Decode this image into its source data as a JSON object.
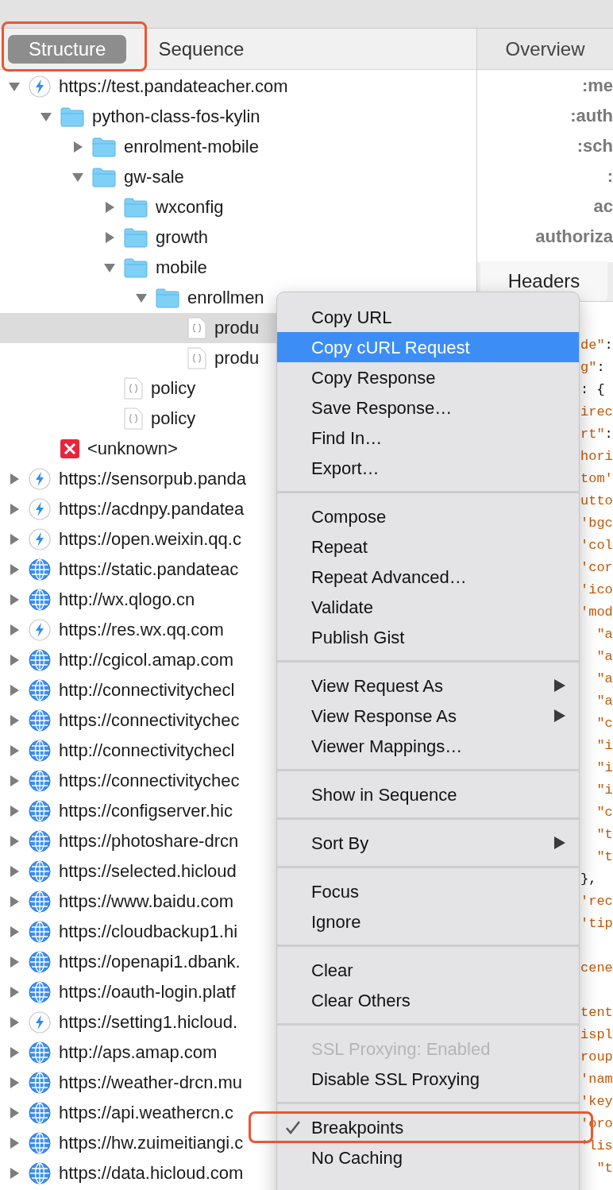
{
  "tabs": [
    {
      "label": "Structure",
      "selected": true,
      "annotated": true
    },
    {
      "label": "Sequence",
      "selected": false,
      "annotated": false
    }
  ],
  "tree": [
    {
      "label": "https://test.pandateacher.com",
      "kind": "lightning",
      "expanded": true,
      "selected": false,
      "children": [
        {
          "label": "python-class-fos-kylin",
          "kind": "folder",
          "expanded": true,
          "selected": false,
          "children": [
            {
              "label": "enrolment-mobile",
              "kind": "folder",
              "expanded": false,
              "selected": false
            },
            {
              "label": "gw-sale",
              "kind": "folder",
              "expanded": true,
              "selected": false,
              "children": [
                {
                  "label": "wxconfig",
                  "kind": "folder",
                  "expanded": false,
                  "selected": false
                },
                {
                  "label": "growth",
                  "kind": "folder",
                  "expanded": false,
                  "selected": false
                },
                {
                  "label": "mobile",
                  "kind": "folder",
                  "expanded": true,
                  "selected": false,
                  "children": [
                    {
                      "label": "enrollmen",
                      "kind": "folder",
                      "expanded": true,
                      "selected": false,
                      "children": [
                        {
                          "label": "produ",
                          "kind": "json",
                          "selected": true
                        },
                        {
                          "label": "produ",
                          "kind": "json",
                          "selected": false
                        }
                      ]
                    }
                  ]
                },
                {
                  "label": "policy",
                  "kind": "json",
                  "selected": false
                },
                {
                  "label": "policy",
                  "kind": "json",
                  "selected": false
                }
              ]
            }
          ]
        },
        {
          "label": "<unknown>",
          "kind": "error",
          "selected": false
        }
      ]
    },
    {
      "label": "https://sensorpub.panda",
      "kind": "lightning",
      "expanded": false,
      "selected": false
    },
    {
      "label": "https://acdnpy.pandatea",
      "kind": "lightning",
      "expanded": false,
      "selected": false
    },
    {
      "label": "https://open.weixin.qq.c",
      "kind": "lightning",
      "expanded": false,
      "selected": false
    },
    {
      "label": "https://static.pandateac",
      "kind": "globe",
      "expanded": false,
      "selected": false
    },
    {
      "label": "http://wx.qlogo.cn",
      "kind": "globe",
      "expanded": false,
      "selected": false
    },
    {
      "label": "https://res.wx.qq.com",
      "kind": "lightning",
      "expanded": false,
      "selected": false
    },
    {
      "label": "http://cgicol.amap.com",
      "kind": "globe",
      "expanded": false,
      "selected": false
    },
    {
      "label": "http://connectivitychecl",
      "kind": "globe",
      "expanded": false,
      "selected": false
    },
    {
      "label": "https://connectivitychec",
      "kind": "globe",
      "expanded": false,
      "selected": false
    },
    {
      "label": "http://connectivitychecl",
      "kind": "globe",
      "expanded": false,
      "selected": false
    },
    {
      "label": "https://connectivitychec",
      "kind": "globe",
      "expanded": false,
      "selected": false
    },
    {
      "label": "https://configserver.hic",
      "kind": "globe",
      "expanded": false,
      "selected": false
    },
    {
      "label": "https://photoshare-drcn",
      "kind": "globe",
      "expanded": false,
      "selected": false
    },
    {
      "label": "https://selected.hicloud",
      "kind": "globe",
      "expanded": false,
      "selected": false
    },
    {
      "label": "https://www.baidu.com",
      "kind": "globe",
      "expanded": false,
      "selected": false
    },
    {
      "label": "https://cloudbackup1.hi",
      "kind": "globe",
      "expanded": false,
      "selected": false
    },
    {
      "label": "https://openapi1.dbank.",
      "kind": "globe",
      "expanded": false,
      "selected": false
    },
    {
      "label": "https://oauth-login.platf",
      "kind": "globe",
      "expanded": false,
      "selected": false
    },
    {
      "label": "https://setting1.hicloud.",
      "kind": "lightning",
      "expanded": false,
      "selected": false
    },
    {
      "label": "http://aps.amap.com",
      "kind": "globe",
      "expanded": false,
      "selected": false
    },
    {
      "label": "https://weather-drcn.mu",
      "kind": "globe",
      "expanded": false,
      "selected": false
    },
    {
      "label": "https://api.weathercn.c",
      "kind": "globe",
      "expanded": false,
      "selected": false
    },
    {
      "label": "https://hw.zuimeitiangi.c",
      "kind": "globe",
      "expanded": false,
      "selected": false
    },
    {
      "label": "https://data.hicloud.com",
      "kind": "globe",
      "expanded": false,
      "selected": false
    }
  ],
  "overview": {
    "title": "Overview",
    "labels": [
      ":me",
      ":auth",
      ":sch",
      ":",
      "ac",
      "authoriza"
    ],
    "tab": "Headers"
  },
  "code_lines": [
    {
      "kind": "code",
      "text": "de\"",
      "punct": ":"
    },
    {
      "kind": "code",
      "text": "g\"",
      "punct": ":"
    },
    {
      "kind": "code",
      "punct": ": {"
    },
    {
      "kind": "code",
      "text": "irec"
    },
    {
      "kind": "code",
      "text": "rt\"",
      "punct": ":"
    },
    {
      "kind": "code",
      "text": "hori"
    },
    {
      "kind": "code",
      "text": "tom'"
    },
    {
      "kind": "code",
      "text": "utto"
    },
    {
      "kind": "code",
      "text": "'bgc"
    },
    {
      "kind": "code",
      "text": "'col"
    },
    {
      "kind": "code",
      "text": "'cor"
    },
    {
      "kind": "code",
      "text": "'ico"
    },
    {
      "kind": "code",
      "text": "'mod"
    },
    {
      "kind": "code",
      "text": "  \"a"
    },
    {
      "kind": "code",
      "text": "  \"a"
    },
    {
      "kind": "code",
      "text": "  \"a"
    },
    {
      "kind": "code",
      "text": "  \"a"
    },
    {
      "kind": "code",
      "text": "  \"c"
    },
    {
      "kind": "code",
      "text": "  \"i"
    },
    {
      "kind": "code",
      "text": "  \"i"
    },
    {
      "kind": "code",
      "text": "  \"i"
    },
    {
      "kind": "code",
      "text": "  \"c"
    },
    {
      "kind": "code",
      "text": "  \"t"
    },
    {
      "kind": "code",
      "text": "  \"t"
    },
    {
      "kind": "code",
      "punct": "},"
    },
    {
      "kind": "code",
      "text": "'rec"
    },
    {
      "kind": "code",
      "text": "'tip"
    },
    {
      "kind": "blank"
    },
    {
      "kind": "code",
      "text": "cene"
    },
    {
      "kind": "blank"
    },
    {
      "kind": "code",
      "text": "tent"
    },
    {
      "kind": "code",
      "text": "ispl"
    },
    {
      "kind": "code",
      "text": "roup"
    },
    {
      "kind": "code",
      "text": "'nam"
    },
    {
      "kind": "code",
      "text": "'key"
    },
    {
      "kind": "code",
      "text": "'oro"
    },
    {
      "kind": "code",
      "text": "'lis"
    },
    {
      "kind": "code",
      "text": "  \"t"
    }
  ],
  "menu": [
    [
      {
        "label": "Copy URL",
        "selected": false
      },
      {
        "label": "Copy cURL Request",
        "selected": true
      },
      {
        "label": "Copy Response",
        "selected": false
      },
      {
        "label": "Save Response…",
        "selected": false
      },
      {
        "label": "Find In…",
        "selected": false
      },
      {
        "label": "Export…",
        "selected": false
      }
    ],
    [
      {
        "label": "Compose",
        "selected": false
      },
      {
        "label": "Repeat",
        "selected": false
      },
      {
        "label": "Repeat Advanced…",
        "selected": false
      },
      {
        "label": "Validate",
        "selected": false
      },
      {
        "label": "Publish Gist",
        "selected": false
      }
    ],
    [
      {
        "label": "View Request As",
        "selected": false,
        "submenu": true
      },
      {
        "label": "View Response As",
        "selected": false,
        "submenu": true
      },
      {
        "label": "Viewer Mappings…",
        "selected": false,
        "submenu": false
      }
    ],
    [
      {
        "label": "Show in Sequence",
        "selected": false
      }
    ],
    [
      {
        "label": "Sort By",
        "selected": false,
        "submenu": true
      }
    ],
    [
      {
        "label": "Focus",
        "selected": false
      },
      {
        "label": "Ignore",
        "selected": false
      }
    ],
    [
      {
        "label": "Clear",
        "selected": false
      },
      {
        "label": "Clear Others",
        "selected": false
      }
    ],
    [
      {
        "label": "SSL Proxying: Enabled",
        "selected": false,
        "disabled": true
      },
      {
        "label": "Disable SSL Proxying",
        "selected": false,
        "disabled": false
      }
    ],
    [
      {
        "label": "Breakpoints",
        "selected": false,
        "checked": true,
        "annotated": true
      },
      {
        "label": "No Caching",
        "selected": false,
        "checked": false,
        "annotated": false
      }
    ]
  ]
}
